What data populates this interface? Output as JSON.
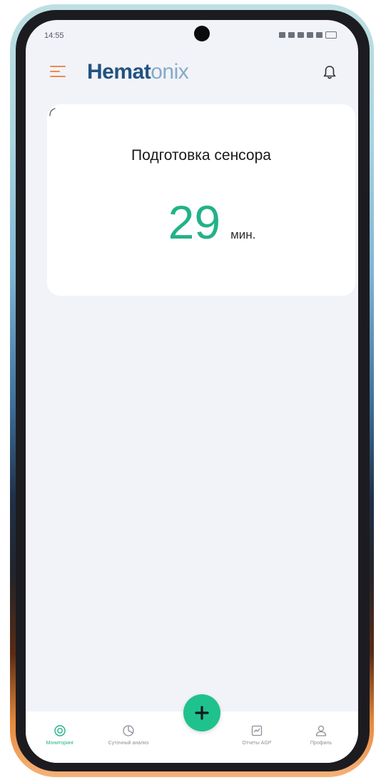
{
  "status_bar": {
    "time": "14:55"
  },
  "header": {
    "brand_part1": "Hemat",
    "brand_part2": "onix",
    "menu_icon": "menu-icon",
    "notification_icon": "bell-icon"
  },
  "sensor_card": {
    "title": "Подготовка сенсора",
    "value": "29",
    "unit": "мин."
  },
  "bottom_nav": {
    "items": [
      {
        "label": "Мониторинг",
        "icon": "target-icon",
        "active": true
      },
      {
        "label": "Суточный анализ",
        "icon": "chart-circle-icon",
        "active": false
      },
      {
        "label": "Отчеты АGP",
        "icon": "report-icon",
        "active": false
      },
      {
        "label": "Профиль",
        "icon": "user-icon",
        "active": false
      }
    ],
    "fab_icon": "plus-icon"
  },
  "colors": {
    "accent": "#22b288",
    "brand_dark": "#24527f",
    "brand_light": "#85a9c9",
    "menu_orange": "#f08a4b",
    "background": "#f1f3f8"
  }
}
